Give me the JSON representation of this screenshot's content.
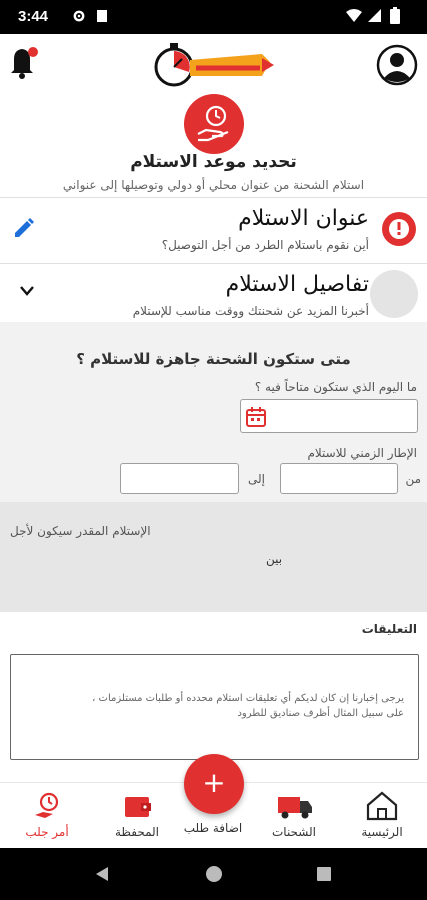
{
  "status_bar": {
    "time": "3:44"
  },
  "hero": {
    "title": "تحديد موعد الاستلام",
    "subtitle": "استلام الشحنة من عنوان محلي أو دولي وتوصيلها إلى عنواني"
  },
  "pickup_address": {
    "title": "عنوان الاستلام",
    "subtitle": "أين نقوم باستلام الطرد من أجل التوصيل؟"
  },
  "pickup_details": {
    "title": "تفاصيل الاستلام",
    "subtitle": "أخبرنا المزيد عن شحنتك ووقت مناسب للإستلام"
  },
  "ready_form": {
    "question": "متى ستكون الشحنة جاهزة للاستلام ؟",
    "day_label": "ما اليوم الذي ستكون متاحاً فيه ؟",
    "day_value": "",
    "timeframe_label": "الإطار الزمني للاستلام",
    "from_label": "من",
    "to_label": "إلى",
    "from_value": "",
    "to_value": ""
  },
  "estimate": {
    "label": "الإستلام المقدر سيكون لأجل",
    "between": "بين"
  },
  "comments": {
    "label": "التعليقات",
    "placeholder": "يرجى إخبارنا إن كان لديكم أي تعليقات استلام محدده أو طلبات مستلزمات ، على سبيل المثال أظرف صناديق للطرود"
  },
  "fab": {
    "symbol": "+"
  },
  "bottom_nav": [
    {
      "label": "الرئيسية",
      "icon": "home-icon"
    },
    {
      "label": "الشحنات",
      "icon": "truck-icon"
    },
    {
      "label": "اضافة طلب",
      "icon": "add-icon"
    },
    {
      "label": "المحفظة",
      "icon": "wallet-icon"
    },
    {
      "label": "أمر جلب",
      "icon": "pickup-clock-icon",
      "active": true
    }
  ],
  "colors": {
    "accent": "#e0302f",
    "text": "#222222"
  }
}
